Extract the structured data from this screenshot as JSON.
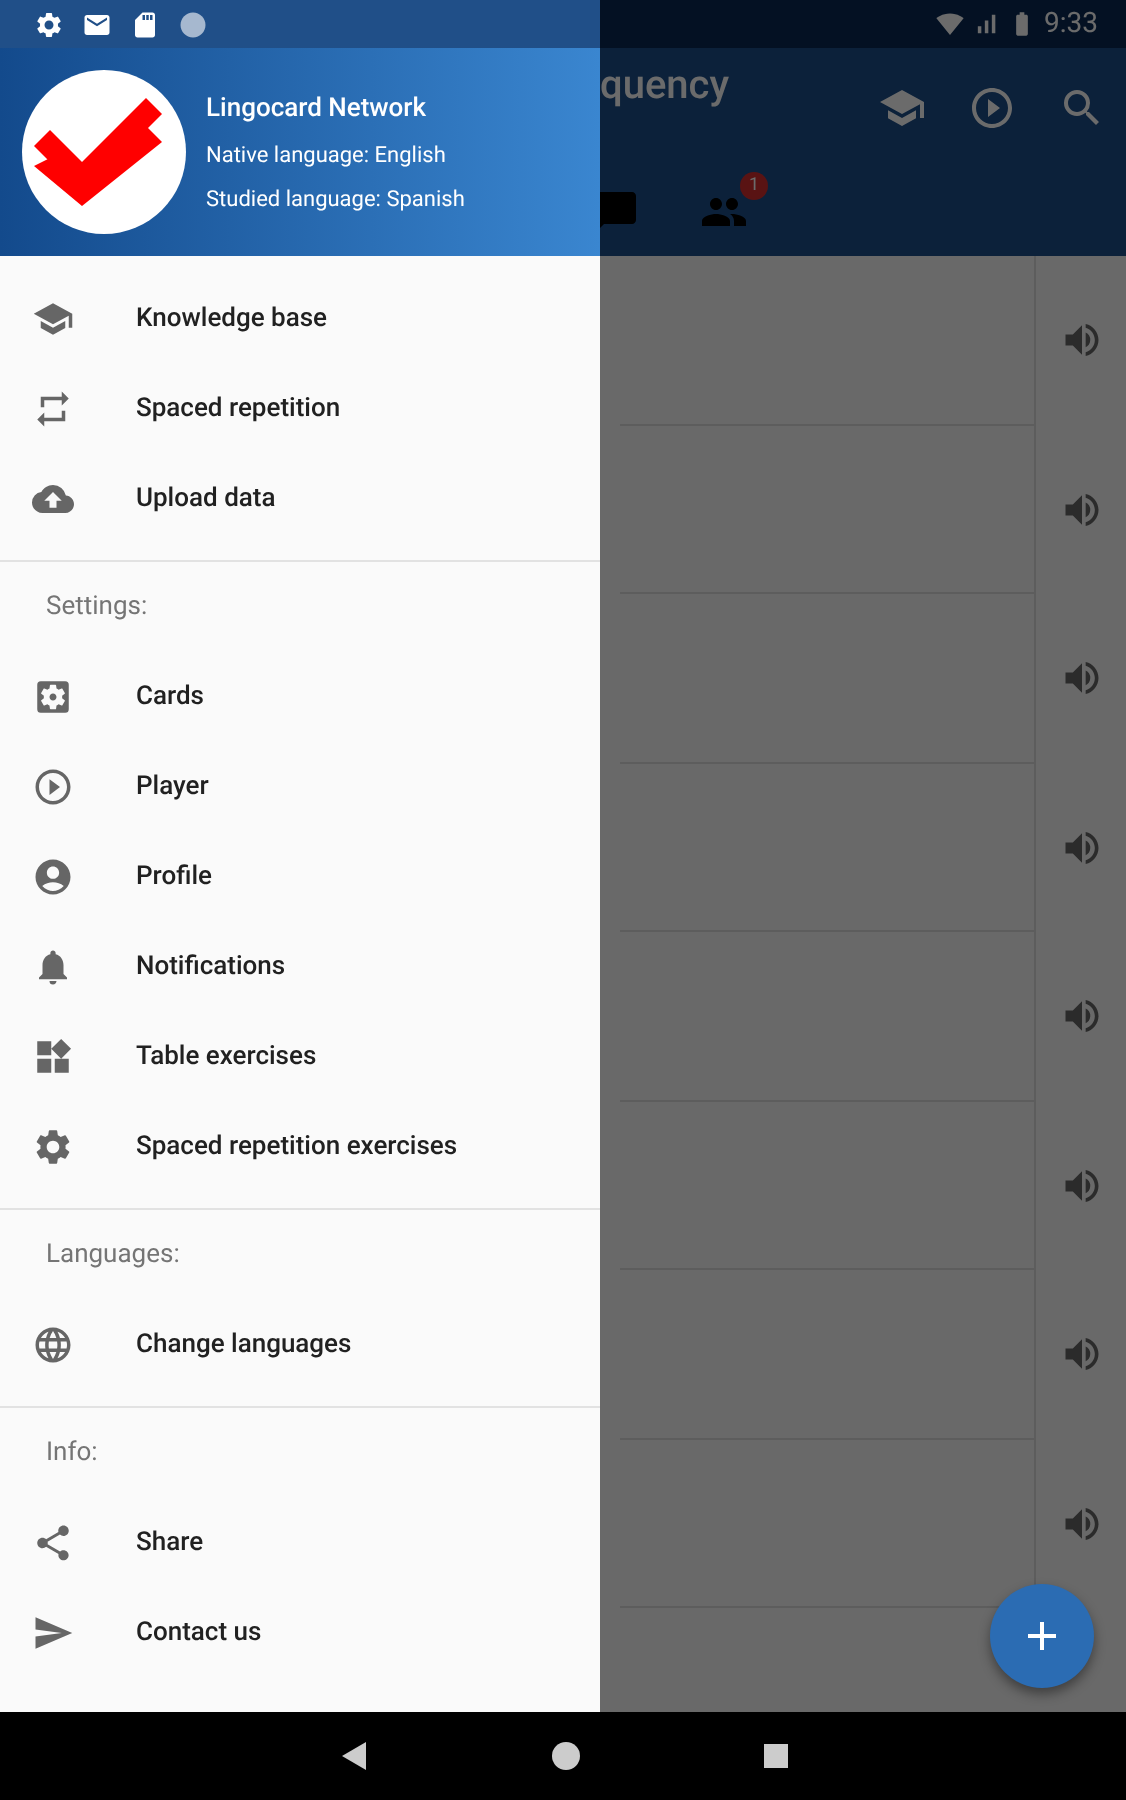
{
  "status_bar": {
    "time": "9:33"
  },
  "app_bar": {
    "title": "quency"
  },
  "tabs": {
    "badge": "1"
  },
  "drawer": {
    "header": {
      "title": "Lingocard Network",
      "native": "Native language: English",
      "studied": "Studied language: Spanish"
    },
    "sections": [
      {
        "items": [
          "Knowledge base",
          "Spaced repetition",
          "Upload data"
        ]
      },
      {
        "label": "Settings:",
        "items": [
          "Cards",
          "Player",
          "Profile",
          "Notifications",
          "Table exercises",
          "Spaced repetition exercises"
        ]
      },
      {
        "label": "Languages:",
        "items": [
          "Change languages"
        ]
      },
      {
        "label": "Info:",
        "items": [
          "Share",
          "Contact us"
        ]
      }
    ]
  }
}
